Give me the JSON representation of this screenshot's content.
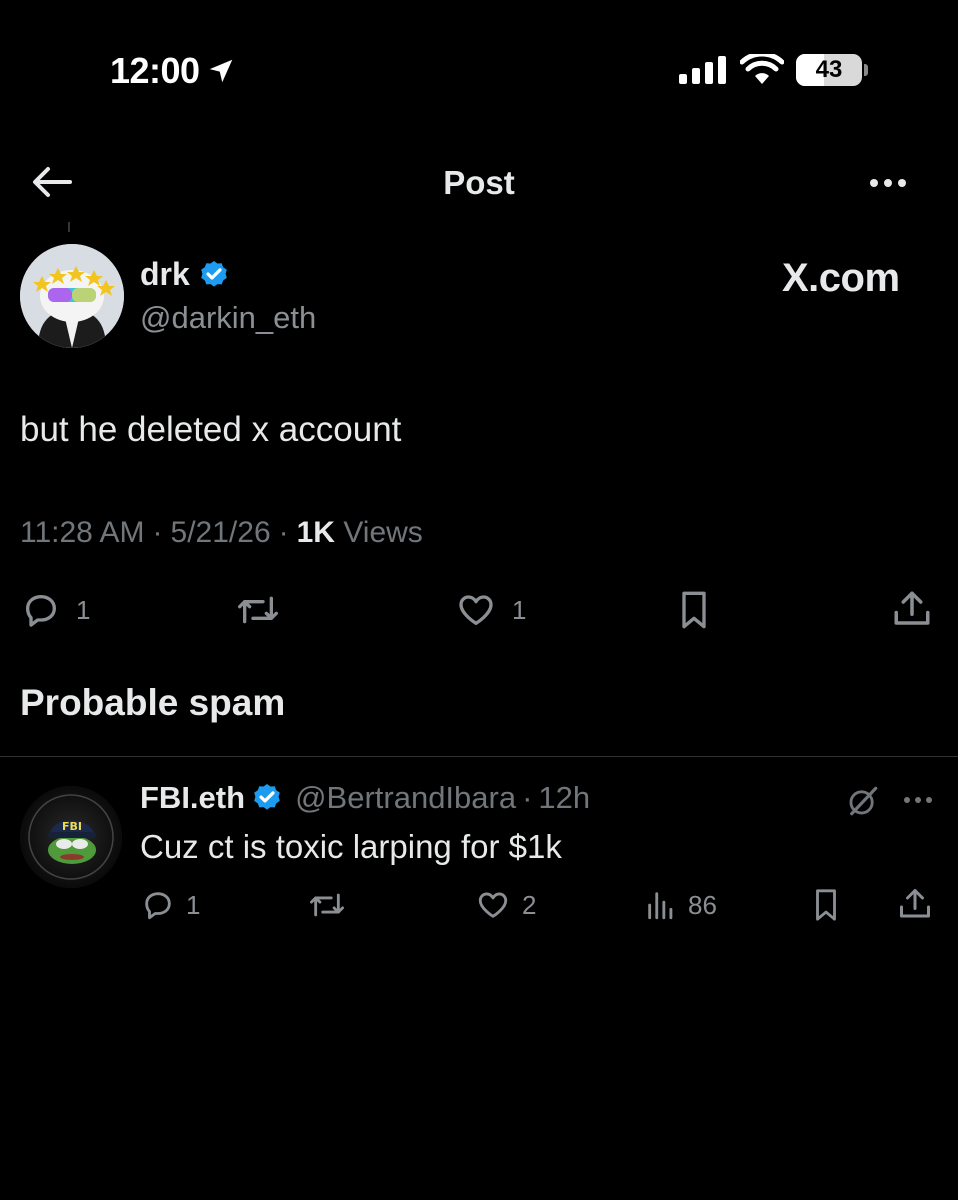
{
  "status_bar": {
    "time": "12:00",
    "battery": "43"
  },
  "top_bar": {
    "title": "Post"
  },
  "post": {
    "author_name": "drk",
    "author_handle": "@darkin_eth",
    "brand_text": "X.com",
    "text": "but he deleted x account",
    "time": "11:28 AM",
    "date": "5/21/26",
    "views_count": "1K",
    "views_label": "Views",
    "separator": "·",
    "actions": {
      "replies": "1",
      "likes": "1"
    }
  },
  "section_heading": "Probable spam",
  "reply": {
    "author_name": "FBI.eth",
    "author_handle": "@BertrandIbara",
    "separator": "·",
    "time": "12h",
    "avatar_text": "FBI",
    "text": "Cuz ct is toxic larping for $1k",
    "actions": {
      "replies": "1",
      "likes": "2",
      "views": "86"
    }
  },
  "colors": {
    "background": "#000000",
    "text_primary": "#e7e9ea",
    "text_secondary": "#71767b",
    "verified_badge": "#1d9bf0",
    "divider": "#2f3336"
  },
  "icons": [
    "location-arrow-icon",
    "signal-icon",
    "wifi-icon",
    "battery-icon",
    "back-arrow-icon",
    "more-icon",
    "verified-icon",
    "reply-icon",
    "repost-icon",
    "like-icon",
    "bookmark-icon",
    "share-icon",
    "views-icon",
    "grok-icon"
  ]
}
